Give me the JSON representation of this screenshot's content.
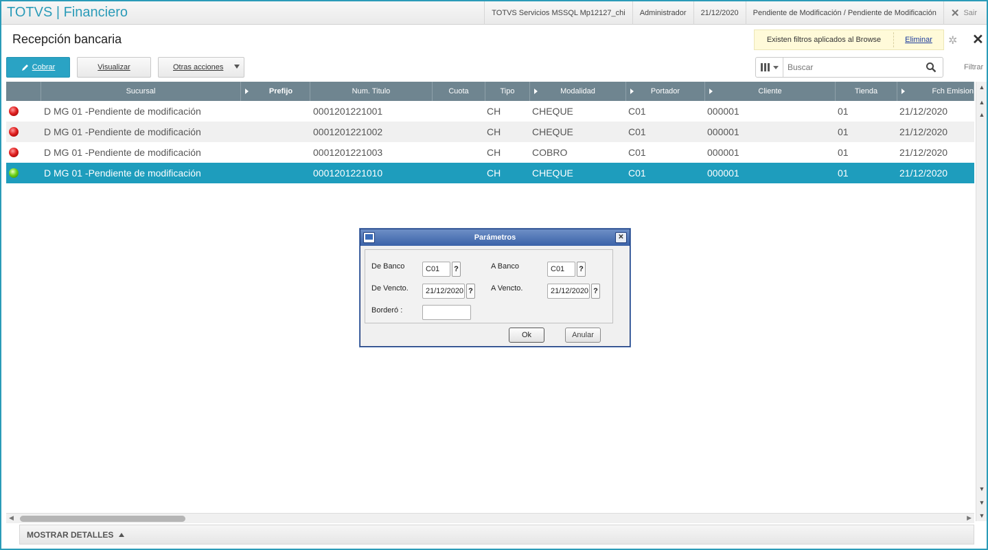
{
  "app": {
    "brand": "TOTVS",
    "separator": "|",
    "module": "Financiero"
  },
  "topbar": {
    "environment": "TOTVS Servicios MSSQL Mp12127_chi",
    "user": "Administrador",
    "date": "21/12/2020",
    "status": "Pendiente de Modificación / Pendiente de Modificación",
    "exit_label": "Sair"
  },
  "page": {
    "title": "Recepción bancaria"
  },
  "filter_notice": {
    "text": "Existen filtros aplicados al Browse",
    "remove_link": "Eliminar"
  },
  "toolbar": {
    "primary_label": "Cobrar",
    "view_label": "Visualizar",
    "more_label": "Otras acciones",
    "search_placeholder": "Buscar",
    "filter_label": "Filtrar"
  },
  "grid": {
    "columns": [
      "Sucursal",
      "Prefijo",
      "Num. Titulo",
      "Cuota",
      "Tipo",
      "Modalidad",
      "Portador",
      "Cliente",
      "Tienda",
      "Fch Emision"
    ],
    "rows": [
      {
        "status": "red",
        "sucursal": "D MG 01 -Pendiente de modificación",
        "num_titulo": "0001201221001",
        "tipo": "CH",
        "modalidad": "CHEQUE",
        "portador": "C01",
        "cliente": "000001",
        "tienda": "01",
        "fch_emision": "21/12/2020"
      },
      {
        "status": "red",
        "sucursal": "D MG 01 -Pendiente de modificación",
        "num_titulo": "0001201221002",
        "tipo": "CH",
        "modalidad": "CHEQUE",
        "portador": "C01",
        "cliente": "000001",
        "tienda": "01",
        "fch_emision": "21/12/2020"
      },
      {
        "status": "red",
        "sucursal": "D MG 01 -Pendiente de modificación",
        "num_titulo": "0001201221003",
        "tipo": "CH",
        "modalidad": "COBRO",
        "portador": "C01",
        "cliente": "000001",
        "tienda": "01",
        "fch_emision": "21/12/2020"
      },
      {
        "status": "green",
        "sucursal": "D MG 01 -Pendiente de modificación",
        "num_titulo": "0001201221010",
        "tipo": "CH",
        "modalidad": "CHEQUE",
        "portador": "C01",
        "cliente": "000001",
        "tienda": "01",
        "fch_emision": "21/12/2020"
      }
    ]
  },
  "details": {
    "label": "MOSTRAR DETALLES"
  },
  "dialog": {
    "title": "Parámetros",
    "de_banco_label": "De Banco",
    "de_banco_value": "C01",
    "a_banco_label": "A  Banco",
    "a_banco_value": "C01",
    "de_vencto_label": "De Vencto.",
    "de_vencto_value": "21/12/2020",
    "a_vencto_label": "A  Vencto.",
    "a_vencto_value": "21/12/2020",
    "bordero_label": "Borderó :",
    "bordero_value": "",
    "lookup_label": "?",
    "ok_label": "Ok",
    "cancel_label": "Anular"
  },
  "colors": {
    "accent": "#2a9bb8",
    "selected_row": "#1e9dbd",
    "grid_header": "#6f8590",
    "status_red": "#e02020",
    "status_green": "#6ed21a"
  }
}
